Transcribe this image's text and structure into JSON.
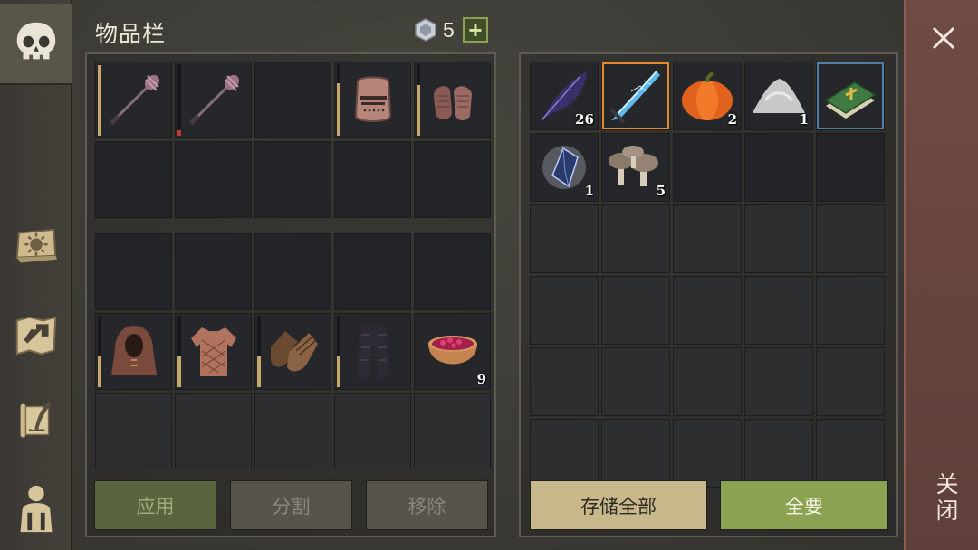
{
  "header": {
    "title": "物品栏",
    "gem_count": "5",
    "plus_label": "+"
  },
  "sidebar": [
    {
      "name": "skull-icon",
      "active": true
    },
    {
      "name": "sun-book-icon"
    },
    {
      "name": "map-arrow-icon"
    },
    {
      "name": "quill-scroll-icon"
    },
    {
      "name": "character-silhouette-icon"
    }
  ],
  "equipment_slots": [
    {
      "icon": "mace-icon",
      "durability": 1.0
    },
    {
      "icon": "mace-icon",
      "durability": 0.08,
      "low": true
    },
    {
      "icon": ""
    },
    {
      "icon": "great-helm-icon",
      "durability": 0.85
    },
    {
      "icon": "chainmail-gloves-icon",
      "durability": 0.75
    },
    {
      "icon": ""
    },
    {
      "icon": ""
    },
    {
      "icon": ""
    },
    {
      "icon": ""
    },
    {
      "icon": ""
    }
  ],
  "backpack_slots": [
    {
      "icon": ""
    },
    {
      "icon": ""
    },
    {
      "icon": ""
    },
    {
      "icon": ""
    },
    {
      "icon": ""
    },
    {
      "icon": "hood-icon",
      "durability": 0.45
    },
    {
      "icon": "padded-tunic-icon",
      "durability": 0.45
    },
    {
      "icon": "leather-gloves-icon",
      "durability": 0.45
    },
    {
      "icon": "trousers-icon",
      "durability": 0.45
    },
    {
      "icon": "berry-bowl-icon",
      "qty": "9"
    },
    {
      "icon": ""
    },
    {
      "icon": ""
    },
    {
      "icon": ""
    },
    {
      "icon": ""
    },
    {
      "icon": ""
    }
  ],
  "storage_slots": [
    {
      "icon": "feather-icon",
      "qty": "26"
    },
    {
      "icon": "ice-sword-icon",
      "highlight": "orange"
    },
    {
      "icon": "pumpkin-icon",
      "qty": "2"
    },
    {
      "icon": "salt-pile-icon",
      "qty": "1"
    },
    {
      "icon": "green-book-icon",
      "highlight": "blue"
    },
    {
      "icon": "crystal-shard-icon",
      "qty": "1"
    },
    {
      "icon": "mushroom-icon",
      "qty": "5"
    }
  ],
  "buttons": {
    "apply": "应用",
    "split": "分割",
    "remove": "移除",
    "store_all": "存储全部",
    "take_all": "全要"
  },
  "close_label": "关闭"
}
